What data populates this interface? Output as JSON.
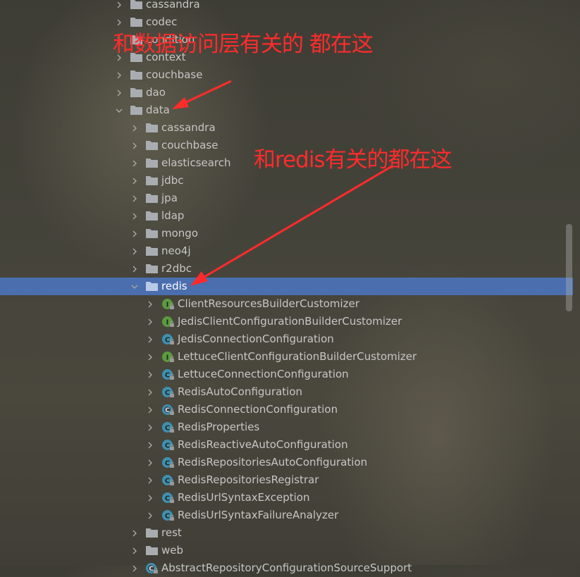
{
  "tree": [
    {
      "label": "cassandra",
      "indent": 0,
      "icon": "folder-icon",
      "expanded": false
    },
    {
      "label": "codec",
      "indent": 0,
      "icon": "folder-icon",
      "expanded": false
    },
    {
      "label": "condition",
      "indent": 0,
      "icon": "folder-icon",
      "expanded": false
    },
    {
      "label": "context",
      "indent": 0,
      "icon": "folder-icon",
      "expanded": false
    },
    {
      "label": "couchbase",
      "indent": 0,
      "icon": "folder-icon",
      "expanded": false
    },
    {
      "label": "dao",
      "indent": 0,
      "icon": "folder-icon",
      "expanded": false
    },
    {
      "label": "data",
      "indent": 0,
      "icon": "folder-icon",
      "expanded": true
    },
    {
      "label": "cassandra",
      "indent": 1,
      "icon": "folder-icon",
      "expanded": false
    },
    {
      "label": "couchbase",
      "indent": 1,
      "icon": "folder-icon",
      "expanded": false
    },
    {
      "label": "elasticsearch",
      "indent": 1,
      "icon": "folder-icon",
      "expanded": false
    },
    {
      "label": "jdbc",
      "indent": 1,
      "icon": "folder-icon",
      "expanded": false
    },
    {
      "label": "jpa",
      "indent": 1,
      "icon": "folder-icon",
      "expanded": false
    },
    {
      "label": "ldap",
      "indent": 1,
      "icon": "folder-icon",
      "expanded": false
    },
    {
      "label": "mongo",
      "indent": 1,
      "icon": "folder-icon",
      "expanded": false
    },
    {
      "label": "neo4j",
      "indent": 1,
      "icon": "folder-icon",
      "expanded": false
    },
    {
      "label": "r2dbc",
      "indent": 1,
      "icon": "folder-icon",
      "expanded": false
    },
    {
      "label": "redis",
      "indent": 1,
      "icon": "folder-icon",
      "expanded": true,
      "selected": true
    },
    {
      "label": "ClientResourcesBuilderCustomizer",
      "indent": 2,
      "icon": "interface-icon",
      "expanded": false
    },
    {
      "label": "JedisClientConfigurationBuilderCustomizer",
      "indent": 2,
      "icon": "interface-icon",
      "expanded": false
    },
    {
      "label": "JedisConnectionConfiguration",
      "indent": 2,
      "icon": "class-icon",
      "expanded": false
    },
    {
      "label": "LettuceClientConfigurationBuilderCustomizer",
      "indent": 2,
      "icon": "interface-icon",
      "expanded": false
    },
    {
      "label": "LettuceConnectionConfiguration",
      "indent": 2,
      "icon": "class-icon",
      "expanded": false
    },
    {
      "label": "RedisAutoConfiguration",
      "indent": 2,
      "icon": "class-icon",
      "expanded": false
    },
    {
      "label": "RedisConnectionConfiguration",
      "indent": 2,
      "icon": "abstract-class-icon",
      "expanded": false
    },
    {
      "label": "RedisProperties",
      "indent": 2,
      "icon": "class-icon",
      "expanded": false
    },
    {
      "label": "RedisReactiveAutoConfiguration",
      "indent": 2,
      "icon": "class-icon",
      "expanded": false
    },
    {
      "label": "RedisRepositoriesAutoConfiguration",
      "indent": 2,
      "icon": "class-icon",
      "expanded": false
    },
    {
      "label": "RedisRepositoriesRegistrar",
      "indent": 2,
      "icon": "class-icon",
      "expanded": false
    },
    {
      "label": "RedisUrlSyntaxException",
      "indent": 2,
      "icon": "class-icon",
      "expanded": false
    },
    {
      "label": "RedisUrlSyntaxFailureAnalyzer",
      "indent": 2,
      "icon": "class-icon",
      "expanded": false
    },
    {
      "label": "rest",
      "indent": 1,
      "icon": "folder-icon",
      "expanded": false
    },
    {
      "label": "web",
      "indent": 1,
      "icon": "folder-icon",
      "expanded": false
    },
    {
      "label": "AbstractRepositoryConfigurationSourceSupport",
      "indent": 1,
      "icon": "abstract-class-icon",
      "expanded": false
    }
  ],
  "annotations": {
    "data_note": "和数据访问层有关的 都在这",
    "redis_note": "和redis有关的都在这",
    "color": "#ff2b2b"
  },
  "colors": {
    "selection": "#4b6eaf",
    "folder": "#a9adb1",
    "class_badge": "#3f8fb0",
    "interface_badge": "#5c9a3f"
  }
}
